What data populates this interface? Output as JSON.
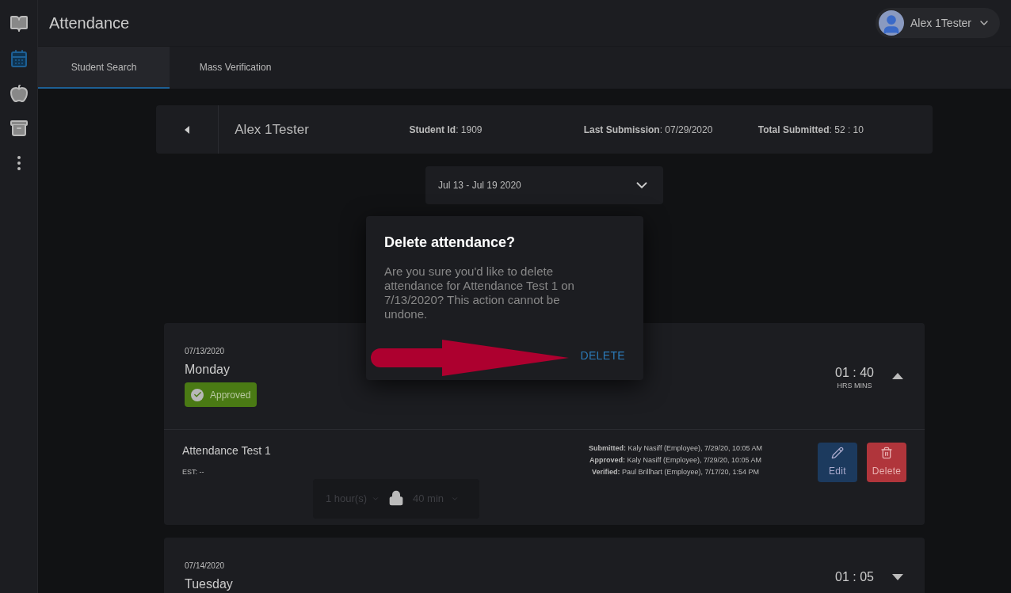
{
  "header": {
    "title": "Attendance",
    "user": {
      "name": "Alex 1Tester"
    }
  },
  "sidebar": {
    "items": [
      {
        "selected": false
      },
      {
        "selected": true
      },
      {
        "selected": false
      },
      {
        "selected": false
      },
      {
        "selected": false
      }
    ]
  },
  "tabs": [
    {
      "label": "Student Search",
      "selected": true
    },
    {
      "label": "Mass Verification",
      "selected": false
    }
  ],
  "student": {
    "name": "Alex 1Tester",
    "fields": [
      "**Student Id**: 1909",
      "**Last Submission**: 07/29/2020",
      "**Total Submitted**: 52 : 10"
    ]
  },
  "week_select": {
    "value": "Jul 13 - Jul 19 2020"
  },
  "days": [
    {
      "date": "07/13/2020",
      "weekday": "Monday",
      "status": {
        "kind": "approved",
        "label": "Approved"
      },
      "time": "01 : 40",
      "time_units": "HRS MINS",
      "expanded": true,
      "entries": [
        {
          "title": "Attendance Test 1",
          "est": "EST: --",
          "log": [
            "**Submitted:** Kaly Nasiff (Employee), 7/29/20, 10:05 AM",
            "**Approved:** Kaly Nasiff (Employee), 7/29/20, 10:05 AM",
            "**Verified:** Paul Brillhart (Employee), 7/17/20, 1:54 PM"
          ],
          "hours": "1 hour(s)",
          "minutes": "40 min",
          "locked": true,
          "buttons": [
            {
              "kind": "edit",
              "label": "Edit"
            },
            {
              "kind": "delete",
              "label": "Delete"
            }
          ]
        }
      ]
    },
    {
      "date": "07/14/2020",
      "weekday": "Tuesday",
      "time": "01 : 05",
      "expanded": false
    }
  ],
  "dialog": {
    "title": "Delete attendance?",
    "message": "Are you sure you'd like to delete attendance for Attendance Test 1 on 7/13/2020? This action cannot be undone.",
    "confirm": "DELETE"
  }
}
